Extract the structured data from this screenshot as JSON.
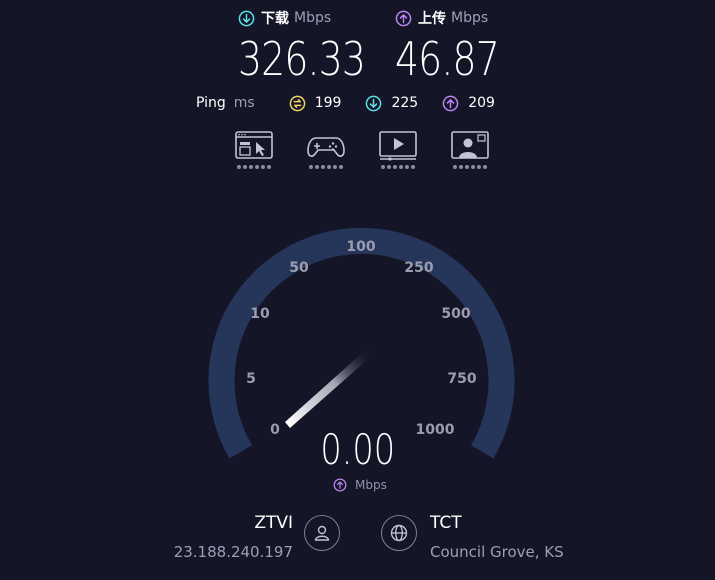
{
  "download": {
    "label": "下载",
    "unit": "Mbps",
    "value": "326.33",
    "icon": "download-circle-icon",
    "color": "#5ce1e6"
  },
  "upload": {
    "label": "上传",
    "unit": "Mbps",
    "value": "46.87",
    "icon": "upload-circle-icon",
    "color": "#b885f5"
  },
  "ping": {
    "label": "Ping",
    "unit": "ms",
    "idle": {
      "value": "199",
      "icon": "ping-idle-icon",
      "color": "#f2d55e"
    },
    "download": {
      "value": "225",
      "icon": "ping-download-icon",
      "color": "#5ce1e6"
    },
    "upload": {
      "value": "209",
      "icon": "ping-upload-icon",
      "color": "#b885f5"
    }
  },
  "quality_icons": [
    "web-browsing-icon",
    "gaming-icon",
    "video-streaming-icon",
    "video-chat-icon"
  ],
  "gauge": {
    "ticks": [
      "0",
      "5",
      "10",
      "50",
      "100",
      "250",
      "500",
      "750",
      "1000"
    ],
    "current_value": "0.00",
    "unit": "Mbps",
    "mode_icon": "upload-circle-icon",
    "track_color": "#26365a",
    "needle_color": "#ffffff"
  },
  "isp": {
    "name": "ZTVI",
    "ip": "23.188.240.197",
    "icon": "user-icon"
  },
  "server": {
    "name": "TCT",
    "location": "Council Grove, KS",
    "icon": "globe-icon"
  }
}
